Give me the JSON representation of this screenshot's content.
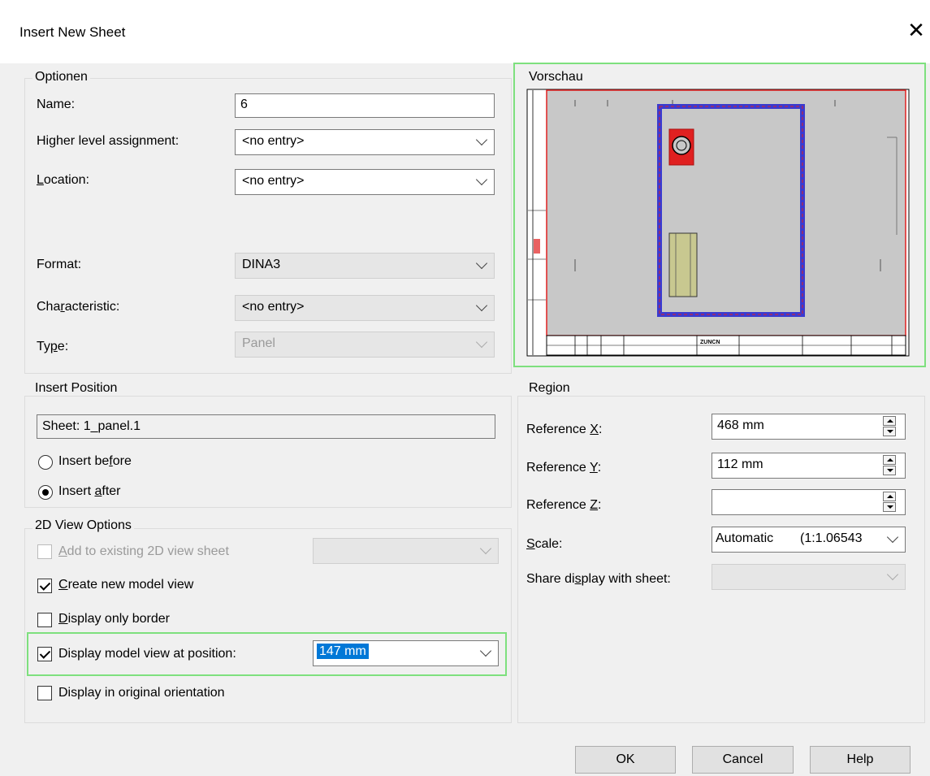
{
  "dialog": {
    "title": "Insert New Sheet",
    "close_label": "✕"
  },
  "options": {
    "legend": "Optionen",
    "name_label": "Name:",
    "name_value": "6",
    "higher_level_label": "Higher level assignment:",
    "higher_level_value": "<no entry>",
    "location_label": "Location:",
    "location_value": "<no entry>",
    "format_label": "Format:",
    "format_value": "DINA3",
    "characteristic_label": "Characteristic:",
    "characteristic_value": "<no entry>",
    "type_label": "Type:",
    "type_value": "Panel"
  },
  "preview": {
    "legend": "Vorschau",
    "stamp_text": "ZUNCN"
  },
  "insert_position": {
    "legend": "Insert Position",
    "sheet_value": "Sheet: 1_panel.1",
    "insert_before_label": "Insert before",
    "insert_after_label": "Insert after",
    "selected": "insert_after"
  },
  "view_options": {
    "legend": "2D View Options",
    "add_existing_label": "Add to existing 2D view sheet",
    "add_existing_checked": false,
    "create_new_label": "Create new model view",
    "create_new_checked": true,
    "only_border_label": "Display only border",
    "only_border_checked": false,
    "at_position_label": "Display model view at position:",
    "at_position_checked": true,
    "at_position_value": "147 mm",
    "original_orientation_label": "Display in original orientation",
    "original_orientation_checked": false
  },
  "region": {
    "legend": "Region",
    "ref_x_label": "Reference X:",
    "ref_x_value": "468 mm",
    "ref_y_label": "Reference Y:",
    "ref_y_value": "112 mm",
    "ref_z_label": "Reference Z:",
    "ref_z_value": "",
    "scale_label": "Scale:",
    "scale_mode": "Automatic",
    "scale_ratio": "(1:1.06543",
    "share_label": "Share display with sheet:",
    "share_value": ""
  },
  "buttons": {
    "ok": "OK",
    "cancel": "Cancel",
    "help": "Help"
  },
  "colors": {
    "highlight_border": "#7ee07e",
    "selection_bg": "#0078d7",
    "preview_frame_red": "#e02020",
    "preview_frame_blue": "#3a3ad0"
  }
}
